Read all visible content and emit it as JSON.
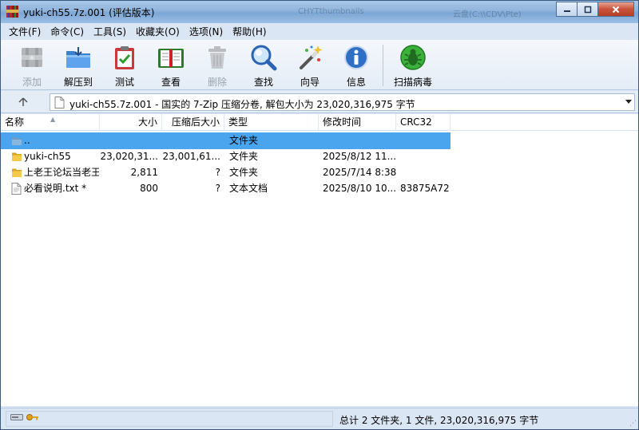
{
  "window": {
    "title": "yuki-ch55.7z.001 (评估版本)",
    "ghost_tabs": [
      "CHYTthumbnails",
      "云盘(C:\\\\CDV\\Pte)"
    ]
  },
  "menu": [
    "文件(F)",
    "命令(C)",
    "工具(S)",
    "收藏夹(O)",
    "选项(N)",
    "帮助(H)"
  ],
  "toolbar": {
    "buttons": [
      {
        "label": "添加",
        "icon": "add-archive-icon",
        "enabled": false
      },
      {
        "label": "解压到",
        "icon": "extract-folder-icon",
        "enabled": true
      },
      {
        "label": "测试",
        "icon": "test-clipboard-icon",
        "enabled": true
      },
      {
        "label": "查看",
        "icon": "view-book-icon",
        "enabled": true
      },
      {
        "label": "删除",
        "icon": "delete-trash-icon",
        "enabled": false
      },
      {
        "label": "查找",
        "icon": "find-magnifier-icon",
        "enabled": true
      },
      {
        "label": "向导",
        "icon": "wizard-wand-icon",
        "enabled": true
      },
      {
        "label": "信息",
        "icon": "info-icon",
        "enabled": true
      },
      {
        "label": "扫描病毒",
        "icon": "virus-scan-icon",
        "enabled": true
      }
    ]
  },
  "address": {
    "text": "yuki-ch55.7z.001 - 国实的 7-Zip 压缩分卷, 解包大小为 23,020,316,975 字节"
  },
  "columns": {
    "name": "名称",
    "size": "大小",
    "packed": "压缩后大小",
    "type": "类型",
    "modified": "修改时间",
    "crc": "CRC32"
  },
  "files": [
    {
      "name": "..",
      "size": "",
      "packed": "",
      "type": "文件夹",
      "modified": "",
      "crc": "",
      "icon": "parent-folder-icon",
      "selected": true
    },
    {
      "name": "yuki-ch55",
      "size": "23,020,31...",
      "packed": "23,001,61...",
      "type": "文件夹",
      "modified": "2025/8/12 11...",
      "crc": "",
      "icon": "folder-icon",
      "selected": false
    },
    {
      "name": "上老王论坛当老王",
      "size": "2,811",
      "packed": "?",
      "type": "文件夹",
      "modified": "2025/7/14 8:38",
      "crc": "",
      "icon": "folder-icon",
      "selected": false
    },
    {
      "name": "必看说明.txt *",
      "size": "800",
      "packed": "?",
      "type": "文本文档",
      "modified": "2025/8/10 10...",
      "crc": "83875A72",
      "icon": "text-file-icon",
      "selected": false
    }
  ],
  "status": {
    "summary": "总计 2 文件夹, 1 文件, 23,020,316,975 字节"
  }
}
